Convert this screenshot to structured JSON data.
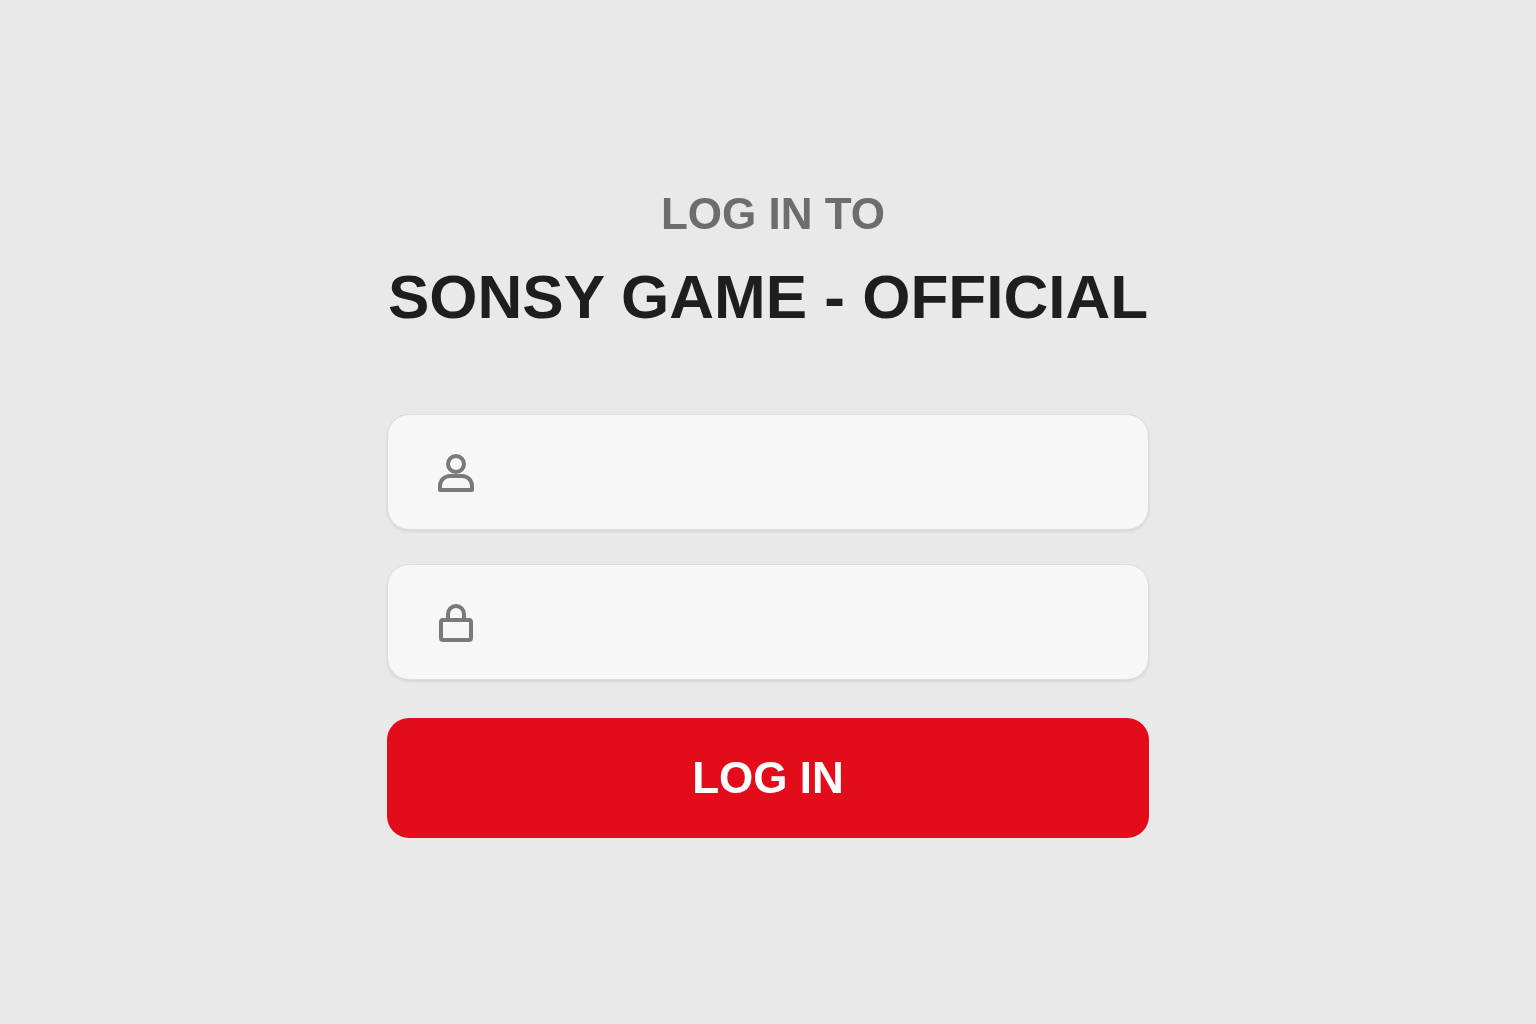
{
  "heading": {
    "subtitle": "LOG IN TO",
    "title": "SONSY GAME - OFFICIAL"
  },
  "fields": [
    {
      "kind": "user"
    },
    {
      "kind": "password"
    }
  ],
  "button": {
    "label": "LOG IN"
  }
}
